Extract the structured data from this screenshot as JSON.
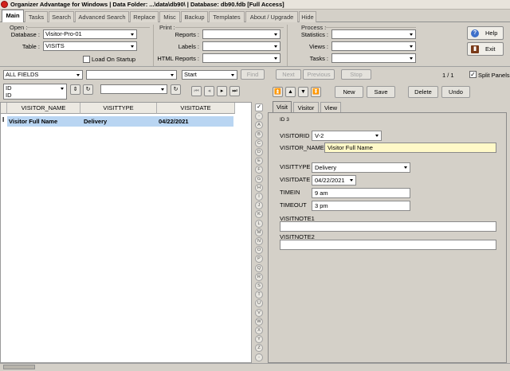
{
  "window": {
    "title": "Organizer Advantage for Windows | Data Folder: ...\\data\\db90\\ | Database: db90.fdb [Full Access]"
  },
  "tabs": [
    "Main",
    "Tasks",
    "Search",
    "Advanced Search",
    "Replace",
    "Misc",
    "Backup",
    "Templates",
    "About / Upgrade",
    "Hide"
  ],
  "open": {
    "title": "Open :",
    "database_label": "Database :",
    "database_value": "Visitor-Pro-01",
    "table_label": "Table :",
    "table_value": "VISITS",
    "load_on_startup": "Load On Startup"
  },
  "print": {
    "title": "Print :",
    "reports_label": "Reports :",
    "labels_label": "Labels :",
    "html_reports_label": "HTML Reports :"
  },
  "process": {
    "title": "Process :",
    "statistics_label": "Statistics :",
    "views_label": "Views :",
    "tasks_label": "Tasks :"
  },
  "buttons": {
    "help": "Help",
    "exit": "Exit"
  },
  "search": {
    "field": "ALL FIELDS",
    "start": "Start",
    "find": "Find",
    "next": "Next",
    "previous": "Previous",
    "stop": "Stop",
    "counter": "1 / 1",
    "split_panels": "Split Panels"
  },
  "sort": {
    "field": "ID",
    "field2": "ID"
  },
  "grid": {
    "columns": [
      "VISITOR_NAME",
      "VISITTYPE",
      "VISITDATE"
    ],
    "row_marker": "I",
    "rows": [
      {
        "visitor_name": "Visitor Full Name",
        "visittype": "Delivery",
        "visitdate": "04/22/2021"
      }
    ]
  },
  "alpha": [
    "✓",
    "-",
    "A",
    "B",
    "C",
    "D",
    "E",
    "F",
    "G",
    "H",
    "I",
    "J",
    "K",
    "L",
    "M",
    "N",
    "O",
    "P",
    "Q",
    "R",
    "S",
    "T",
    "U",
    "V",
    "W",
    "X",
    "Y",
    "Z",
    "-"
  ],
  "record": {
    "new": "New",
    "save": "Save",
    "delete": "Delete",
    "undo": "Undo"
  },
  "form_tabs": [
    "Visit",
    "Visitor",
    "View"
  ],
  "form": {
    "id_label": "ID 3",
    "visitorid_label": "VISITORID",
    "visitorid_value": "V-2",
    "visitor_name_label": "VISITOR_NAME",
    "visitor_name_value": "Visitor Full Name",
    "visittype_label": "VISITTYPE",
    "visittype_value": "Delivery",
    "visitdate_label": "VISITDATE",
    "visitdate_value": "04/22/2021",
    "timein_label": "TIMEIN",
    "timein_value": "9 am",
    "timeout_label": "TIMEOUT",
    "timeout_value": "3 pm",
    "visitnote1_label": "VISITNOTE1",
    "visitnote1_value": "",
    "visitnote2_label": "VISITNOTE2",
    "visitnote2_value": ""
  }
}
